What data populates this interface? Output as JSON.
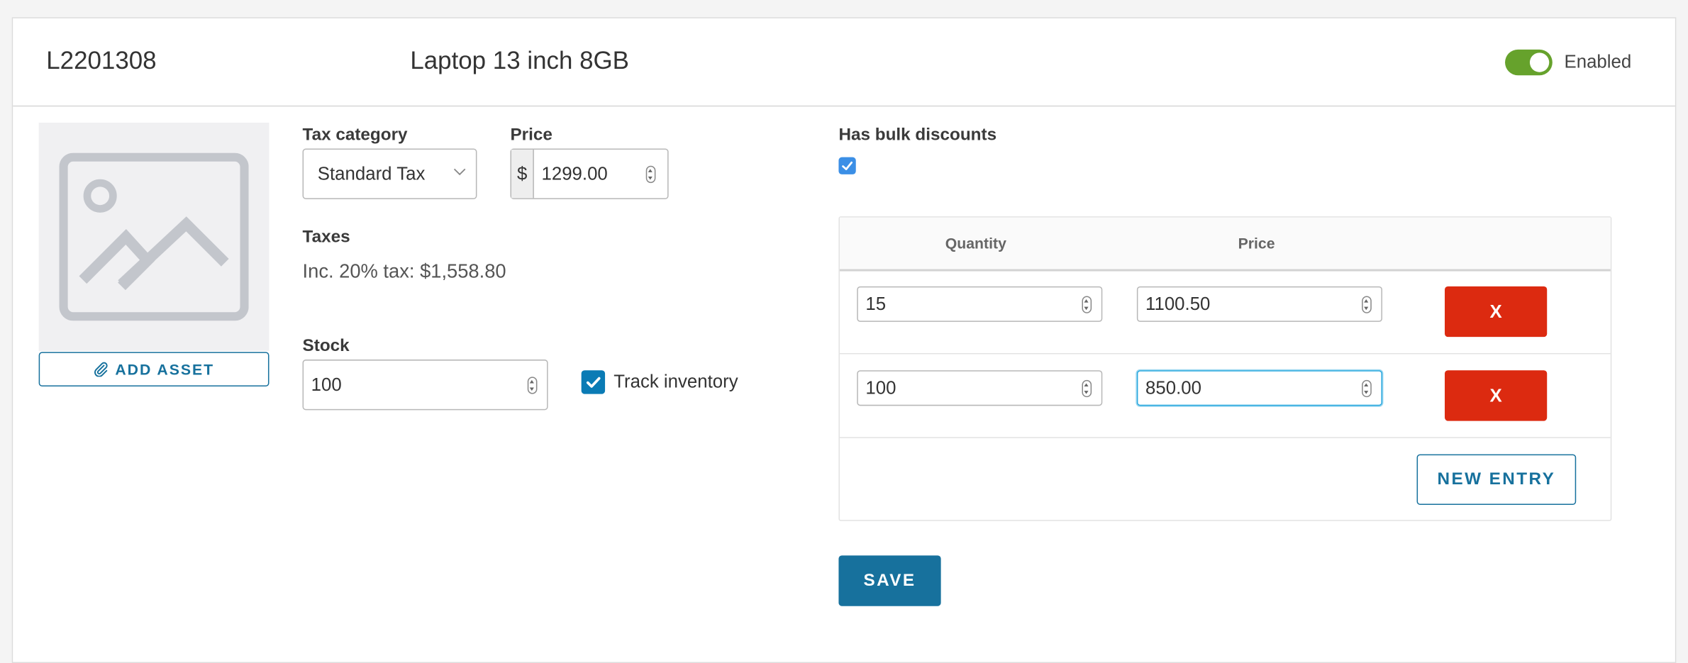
{
  "header": {
    "sku": "L2201308",
    "product_name": "Laptop 13 inch 8GB",
    "enabled_label": "Enabled",
    "enabled": true
  },
  "asset": {
    "add_label": "ADD ASSET"
  },
  "tax_category": {
    "label": "Tax category",
    "value": "Standard Tax"
  },
  "price": {
    "label": "Price",
    "currency": "$",
    "value": "1299.00"
  },
  "taxes": {
    "label": "Taxes",
    "text": "Inc. 20% tax: $1,558.80"
  },
  "stock": {
    "label": "Stock",
    "value": "100",
    "track_label": "Track inventory",
    "track_checked": true
  },
  "bulk": {
    "label": "Has bulk discounts",
    "checked": true,
    "columns": [
      "Quantity",
      "Price"
    ],
    "rows": [
      {
        "quantity": "15",
        "price": "1100.50",
        "delete_label": "X"
      },
      {
        "quantity": "100",
        "price": "850.00",
        "delete_label": "X"
      }
    ],
    "new_entry_label": "NEW ENTRY"
  },
  "save_label": "SAVE",
  "colors": {
    "primary": "#17719d",
    "danger": "#dc2a10",
    "toggle_on": "#66a22c",
    "checkbox": "#0a7bb5"
  }
}
